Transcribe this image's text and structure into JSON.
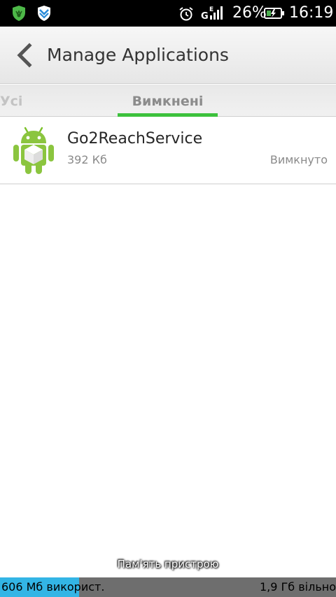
{
  "status_bar": {
    "left_icons": [
      "shield-icon",
      "shield-icon"
    ],
    "network": "E",
    "battery_percent": "26%",
    "time": "16:19"
  },
  "action_bar": {
    "title": "Manage Applications",
    "back_icon": "chevron-left-icon"
  },
  "tabs": [
    {
      "label": "Усі",
      "selected": false
    },
    {
      "label": "Вимкнені",
      "selected": true
    }
  ],
  "apps": [
    {
      "name": "Go2ReachService",
      "size": "392 Кб",
      "status": "Вимкнуто",
      "icon": "android-icon"
    }
  ],
  "storage": {
    "caption": "Пам'ять пристрою",
    "used_label": "606 Мб використ.",
    "free_label": "1,9 Гб вільно",
    "used_fraction": 0.235
  },
  "colors": {
    "accent": "#3cc13c",
    "storage_used": "#33b5e5"
  }
}
